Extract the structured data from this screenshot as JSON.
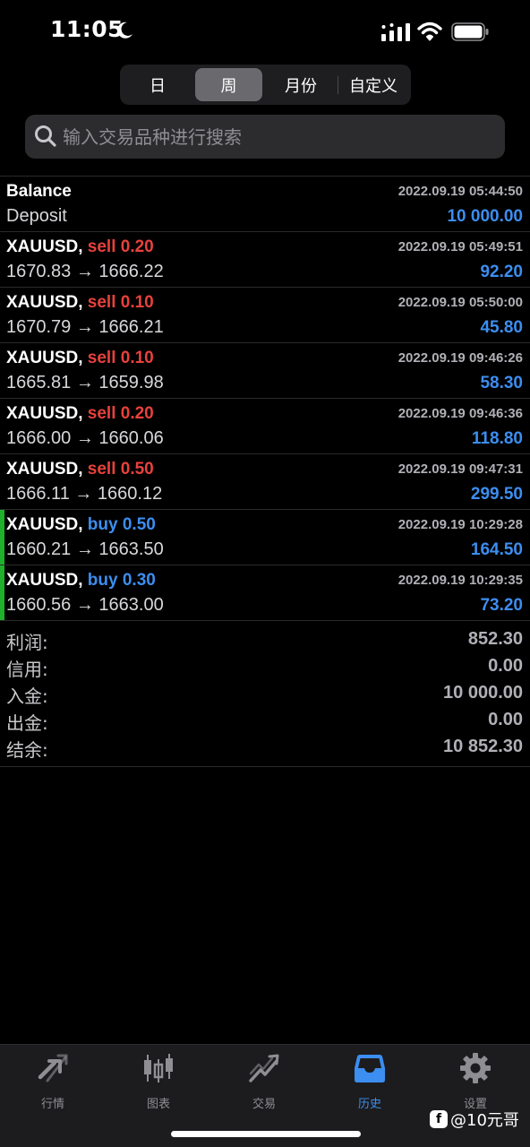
{
  "status_bar": {
    "time": "11:05"
  },
  "period_tabs": [
    {
      "label": "日",
      "active": false
    },
    {
      "label": "周",
      "active": true
    },
    {
      "label": "月份",
      "active": false
    },
    {
      "label": "自定义",
      "active": false
    }
  ],
  "search": {
    "placeholder": "输入交易品种进行搜索"
  },
  "balance_entry": {
    "title": "Balance",
    "subtitle": "Deposit",
    "time": "2022.09.19 05:44:50",
    "amount": "10 000.00"
  },
  "deals": [
    {
      "symbol": "XAUUSD,",
      "direction": "sell 0.20",
      "side": "sell",
      "time": "2022.09.19 05:49:51",
      "prices": "1670.83 → 1666.22",
      "profit": "92.20"
    },
    {
      "symbol": "XAUUSD,",
      "direction": "sell 0.10",
      "side": "sell",
      "time": "2022.09.19 05:50:00",
      "prices": "1670.79 → 1666.21",
      "profit": "45.80"
    },
    {
      "symbol": "XAUUSD,",
      "direction": "sell 0.10",
      "side": "sell",
      "time": "2022.09.19 09:46:26",
      "prices": "1665.81 → 1659.98",
      "profit": "58.30"
    },
    {
      "symbol": "XAUUSD,",
      "direction": "sell 0.20",
      "side": "sell",
      "time": "2022.09.19 09:46:36",
      "prices": "1666.00 → 1660.06",
      "profit": "118.80"
    },
    {
      "symbol": "XAUUSD,",
      "direction": "sell 0.50",
      "side": "sell",
      "time": "2022.09.19 09:47:31",
      "prices": "1666.11 → 1660.12",
      "profit": "299.50"
    },
    {
      "symbol": "XAUUSD,",
      "direction": "buy 0.50",
      "side": "buy",
      "time": "2022.09.19 10:29:28",
      "prices": "1660.21 → 1663.50",
      "profit": "164.50"
    },
    {
      "symbol": "XAUUSD,",
      "direction": "buy 0.30",
      "side": "buy",
      "time": "2022.09.19 10:29:35",
      "prices": "1660.56 → 1663.00",
      "profit": "73.20"
    }
  ],
  "summary": [
    {
      "label": "利润:",
      "value": "852.30"
    },
    {
      "label": "信用:",
      "value": "0.00"
    },
    {
      "label": "入金:",
      "value": "10 000.00"
    },
    {
      "label": "出金:",
      "value": "0.00"
    },
    {
      "label": "结余:",
      "value": "10 852.30"
    }
  ],
  "tabbar": [
    {
      "label": "行情",
      "icon": "quotes-arrows-icon",
      "active": false
    },
    {
      "label": "图表",
      "icon": "candlestick-chart-icon",
      "active": false
    },
    {
      "label": "交易",
      "icon": "trade-trend-icon",
      "active": false
    },
    {
      "label": "历史",
      "icon": "history-inbox-icon",
      "active": true
    },
    {
      "label": "设置",
      "icon": "gear-icon",
      "active": false
    }
  ],
  "watermark": {
    "text": "@10元哥"
  },
  "colors": {
    "sell": "#e8413b",
    "buy": "#3c8ef0",
    "buy_bar": "#1fb02c",
    "active_tab": "#3c8ef0"
  }
}
